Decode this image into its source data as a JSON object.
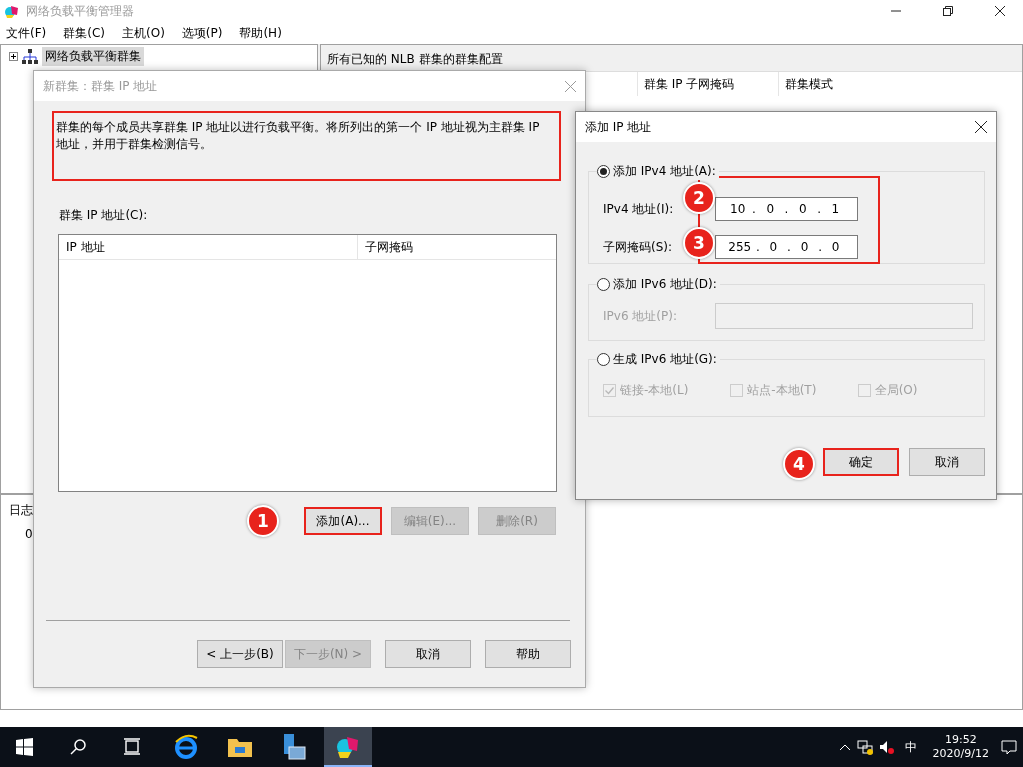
{
  "window": {
    "title": "网络负载平衡管理器",
    "menu": [
      "文件(F)",
      "群集(C)",
      "主机(O)",
      "选项(P)",
      "帮助(H)"
    ]
  },
  "tree": {
    "items": [
      {
        "label": "网络负载平衡群集",
        "expanded": false,
        "selected": true
      }
    ]
  },
  "right_pane": {
    "heading": "所有已知的 NLB 群集的群集配置",
    "columns": [
      "群集 IP 子网掩码",
      "群集模式"
    ]
  },
  "log_pane": {
    "column_1": "日志",
    "row_1": "0"
  },
  "wizard": {
    "title": "新群集：群集 IP 地址",
    "description": "群集的每个成员共享群集 IP 地址以进行负载平衡。将所列出的第一个 IP 地址视为主群集 IP 地址，并用于群集检测信号。",
    "highlighted": true,
    "list_label": "群集 IP 地址(C):",
    "columns": [
      "IP 地址",
      "子网掩码"
    ],
    "list_buttons": [
      {
        "label": "添加(A)...",
        "disabled": false,
        "highlighted": true,
        "step": "1"
      },
      {
        "label": "编辑(E)...",
        "disabled": true,
        "highlighted": false
      },
      {
        "label": "删除(R)",
        "disabled": true,
        "highlighted": false
      }
    ],
    "nav_buttons": [
      {
        "label": "< 上一步(B)",
        "disabled": false
      },
      {
        "label": "下一步(N) >",
        "disabled": true
      },
      {
        "label": "取消",
        "disabled": false
      },
      {
        "label": "帮助",
        "disabled": false
      }
    ]
  },
  "add_dialog": {
    "title": "添加 IP 地址",
    "sections": [
      {
        "kind": "ipv4",
        "label": "添加 IPv4 地址(A):",
        "selected": true,
        "highlighted": true,
        "fields": [
          {
            "label": "IPv4 地址(I):",
            "octets": [
              "10",
              "0",
              "0",
              "1"
            ],
            "separator": ".",
            "step": "2"
          },
          {
            "label": "子网掩码(S):",
            "octets": [
              "255",
              "0",
              "0",
              "0"
            ],
            "separator": ".",
            "step": "3"
          }
        ]
      },
      {
        "kind": "ipv6",
        "label": "添加 IPv6 地址(D):",
        "selected": false,
        "field_label": "IPv6 地址(P):",
        "disabled": true
      },
      {
        "kind": "generate",
        "label": "生成 IPv6 地址(G):",
        "selected": false,
        "options": [
          {
            "label": "链接-本地(L)",
            "checked": true,
            "disabled": true
          },
          {
            "label": "站点-本地(T)",
            "checked": false,
            "disabled": true
          },
          {
            "label": "全局(O)",
            "checked": false,
            "disabled": true
          }
        ]
      }
    ],
    "buttons": [
      {
        "label": "确定",
        "highlighted": true,
        "step": "4"
      },
      {
        "label": "取消",
        "highlighted": false
      }
    ]
  },
  "taskbar": {
    "apps": [
      {
        "kind": "browser",
        "selected": false
      },
      {
        "kind": "folder",
        "selected": false
      },
      {
        "kind": "server",
        "selected": false
      },
      {
        "kind": "nlb",
        "selected": true
      }
    ],
    "ime": "中",
    "time": "19:52",
    "date": "2020/9/12"
  }
}
